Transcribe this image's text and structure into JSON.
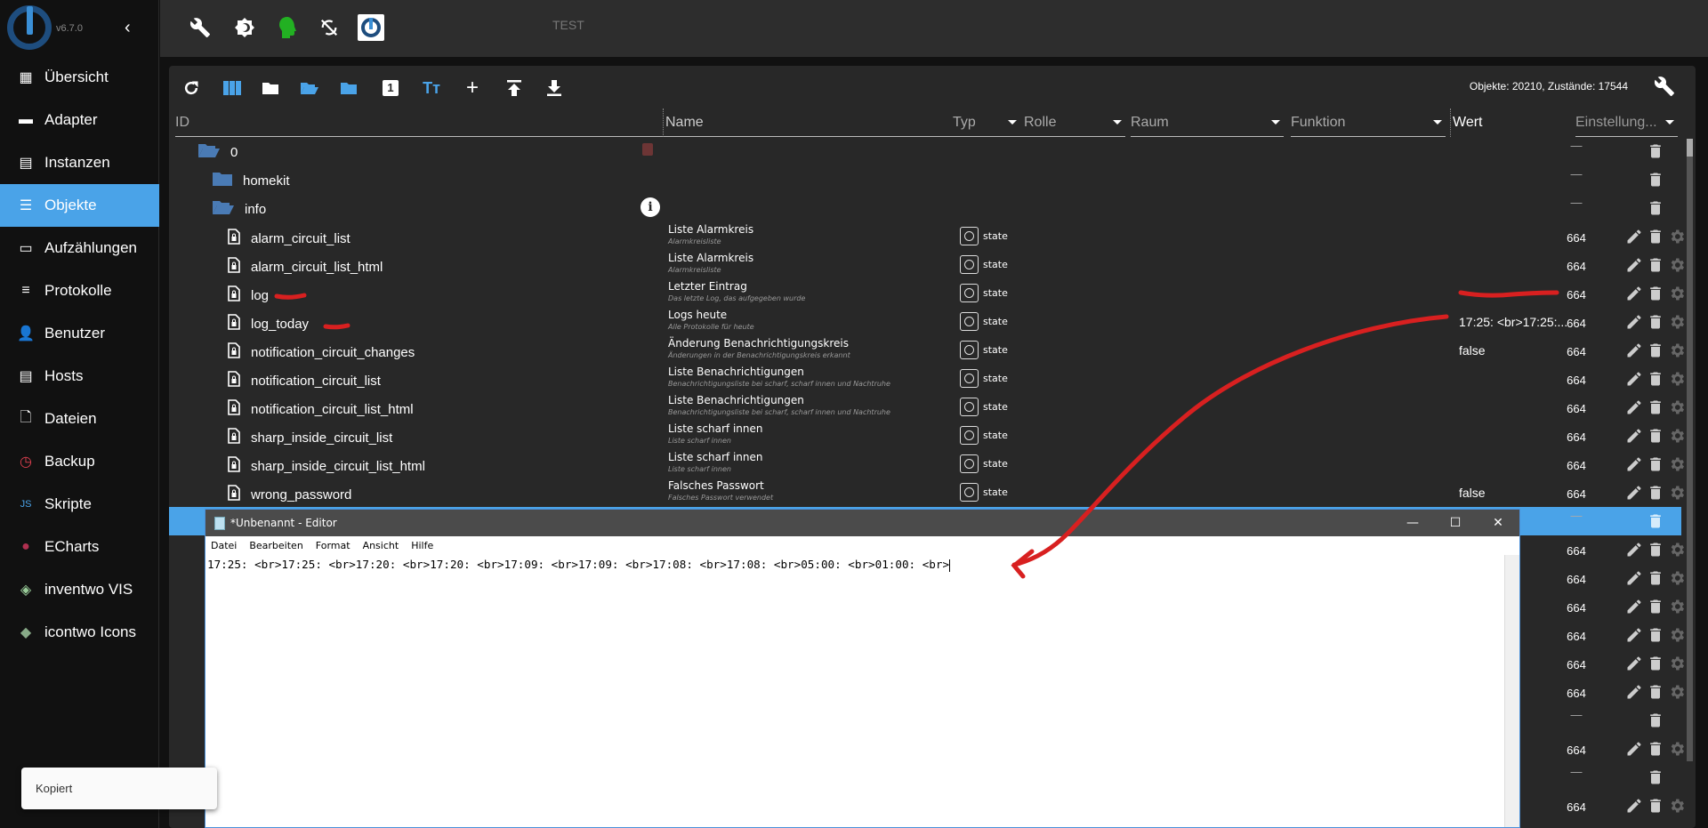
{
  "app": {
    "version": "v6.7.0",
    "instance_label": "TEST"
  },
  "sidebar": {
    "items": [
      {
        "label": "Übersicht",
        "icon": "grid-icon"
      },
      {
        "label": "Adapter",
        "icon": "store-icon"
      },
      {
        "label": "Instanzen",
        "icon": "instances-icon"
      },
      {
        "label": "Objekte",
        "icon": "list-icon",
        "active": true
      },
      {
        "label": "Aufzählungen",
        "icon": "enum-icon"
      },
      {
        "label": "Protokolle",
        "icon": "log-icon"
      },
      {
        "label": "Benutzer",
        "icon": "user-icon"
      },
      {
        "label": "Hosts",
        "icon": "hosts-icon"
      },
      {
        "label": "Dateien",
        "icon": "files-icon"
      },
      {
        "label": "Backup",
        "icon": "backup-icon"
      },
      {
        "label": "Skripte",
        "icon": "js-icon"
      },
      {
        "label": "ECharts",
        "icon": "echarts-icon"
      },
      {
        "label": "inventwo VIS",
        "icon": "inventwo-icon"
      },
      {
        "label": "icontwo Icons",
        "icon": "icontwo-icon"
      }
    ]
  },
  "objects": {
    "count_text": "Objekte: 20210, Zustände: 17544",
    "columns": {
      "id": "ID",
      "name": "Name",
      "type": "Typ",
      "role": "Rolle",
      "room": "Raum",
      "function": "Funktion",
      "value": "Wert",
      "settings": "Einstellung..."
    },
    "rows": [
      {
        "id": "0",
        "icon": "folder-open",
        "level": 0,
        "settings": "—",
        "lock": true
      },
      {
        "id": "homekit",
        "icon": "folder",
        "level": 1,
        "settings": "—"
      },
      {
        "id": "info",
        "icon": "folder-open",
        "level": 1,
        "settings": "—",
        "info": true
      },
      {
        "id": "alarm_circuit_list",
        "icon": "file",
        "level": 2,
        "name": "Liste Alarmkreis",
        "desc": "Alarmkreisliste",
        "type": "state",
        "settings": "664"
      },
      {
        "id": "alarm_circuit_list_html",
        "icon": "file",
        "level": 2,
        "name": "Liste Alarmkreis",
        "desc": "Alarmkreisliste",
        "type": "state",
        "settings": "664"
      },
      {
        "id": "log",
        "icon": "file",
        "level": 2,
        "name": "Letzter Eintrag",
        "desc": "Das letzte Log, das aufgegeben wurde",
        "type": "state",
        "settings": "664"
      },
      {
        "id": "log_today",
        "icon": "file",
        "level": 2,
        "name": "Logs heute",
        "desc": "Alle Protokolle für heute",
        "type": "state",
        "value": "17:25: <br>17:25:...",
        "settings": "664"
      },
      {
        "id": "notification_circuit_changes",
        "icon": "file",
        "level": 2,
        "name": "Änderung Benachrichtigungskreis",
        "desc": "Änderungen in der Benachrichtigungskreis erkannt",
        "type": "state",
        "value": "false",
        "settings": "664"
      },
      {
        "id": "notification_circuit_list",
        "icon": "file",
        "level": 2,
        "name": "Liste Benachrichtigungen",
        "desc": "Benachrichtigungsliste bei scharf, scharf innen und Nachtruhe",
        "type": "state",
        "settings": "664"
      },
      {
        "id": "notification_circuit_list_html",
        "icon": "file",
        "level": 2,
        "name": "Liste Benachrichtigungen",
        "desc": "Benachrichtigungsliste bei scharf, scharf innen und Nachtruhe",
        "type": "state",
        "settings": "664"
      },
      {
        "id": "sharp_inside_circuit_list",
        "icon": "file",
        "level": 2,
        "name": "Liste scharf innen",
        "desc": "Liste scharf innen",
        "type": "state",
        "settings": "664"
      },
      {
        "id": "sharp_inside_circuit_list_html",
        "icon": "file",
        "level": 2,
        "name": "Liste scharf innen",
        "desc": "Liste scharf innen",
        "type": "state",
        "settings": "664"
      },
      {
        "id": "wrong_password",
        "icon": "file",
        "level": 2,
        "name": "Falsches Passwort",
        "desc": "Falsches Passwort verwendet",
        "type": "state",
        "value": "false",
        "settings": "664"
      },
      {
        "selected": true,
        "settings": "—"
      },
      {
        "settings": "664"
      },
      {
        "settings": "664"
      },
      {
        "settings": "664"
      },
      {
        "settings": "664"
      },
      {
        "settings": "664"
      },
      {
        "settings": "664"
      },
      {
        "settings": "—"
      },
      {
        "settings": "664"
      },
      {
        "settings": "—"
      },
      {
        "settings": "664"
      }
    ]
  },
  "editor": {
    "title": "*Unbenannt - Editor",
    "menu": [
      "Datei",
      "Bearbeiten",
      "Format",
      "Ansicht",
      "Hilfe"
    ],
    "content": "17:25: <br>17:25: <br>17:20: <br>17:20: <br>17:09: <br>17:09: <br>17:08: <br>17:08: <br>05:00: <br>01:00: <br>"
  },
  "toast": {
    "text": "Kopiert"
  },
  "colors": {
    "accent": "#4aa3e8",
    "annotation": "#e02020",
    "sidebar_bg": "#111111",
    "panel_bg": "#282828"
  }
}
